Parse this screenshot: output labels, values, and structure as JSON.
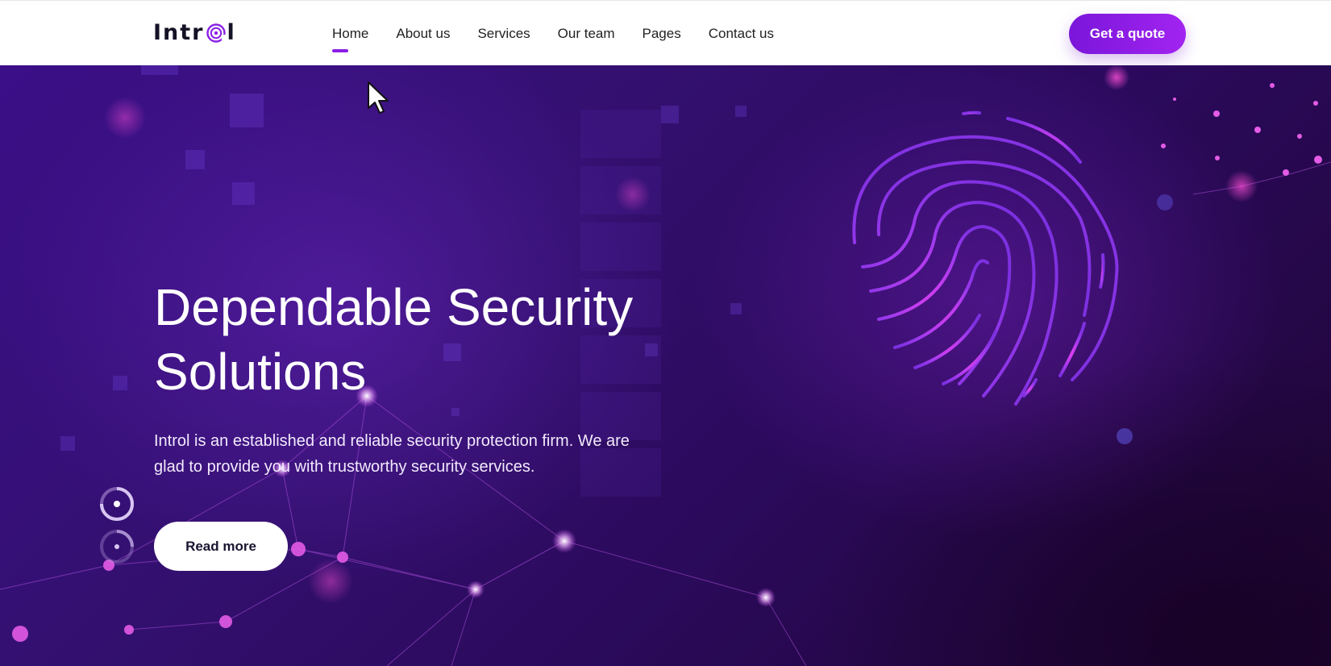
{
  "brand": {
    "name_start": "Intr",
    "name_end": "l",
    "accent": "#8a1fe6"
  },
  "nav": {
    "items": [
      {
        "label": "Home",
        "active": true
      },
      {
        "label": "About us",
        "active": false
      },
      {
        "label": "Services",
        "active": false
      },
      {
        "label": "Our team",
        "active": false
      },
      {
        "label": "Pages",
        "active": false
      },
      {
        "label": "Contact us",
        "active": false
      }
    ],
    "cta_label": "Get a quote"
  },
  "hero": {
    "title_line1": "Dependable Security",
    "title_line2": "Solutions",
    "description": "Introl is an established and reliable security protection firm. We are glad to provide you with trustworthy security services.",
    "button_label": "Read more",
    "background_icon": "fingerprint-icon",
    "slides": {
      "count": 2,
      "active": 1
    }
  },
  "colors": {
    "hero_bg": "#2b0a5c",
    "primary": "#8a1fe6",
    "button_text": "#1a1430"
  }
}
